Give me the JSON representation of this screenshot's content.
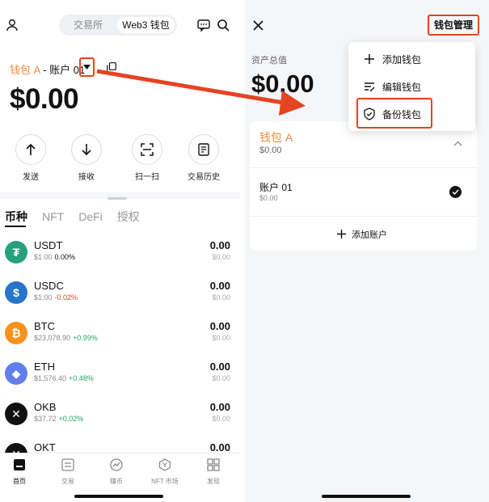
{
  "left": {
    "segment": {
      "option1": "交易所",
      "option2": "Web3 钱包"
    },
    "wallet_name": "钱包 A",
    "wallet_sep": " - ",
    "account_name": "账户 01",
    "balance": "$0.00",
    "actions": [
      {
        "label": "发送",
        "icon": "arrow-up-icon"
      },
      {
        "label": "接收",
        "icon": "arrow-down-icon"
      },
      {
        "label": "扫一扫",
        "icon": "scan-icon"
      },
      {
        "label": "交易历史",
        "icon": "history-icon"
      }
    ],
    "tabs": [
      "币种",
      "NFT",
      "DeFi",
      "授权"
    ],
    "tokens": [
      {
        "symbol": "USDT",
        "price": "$1.00",
        "change": "0.00%",
        "amount": "0.00",
        "usd": "$0.00",
        "color": "#26a17b",
        "glyph": "₮"
      },
      {
        "symbol": "USDC",
        "price": "$1.00",
        "change": "-0.02%",
        "amount": "0.00",
        "usd": "$0.00",
        "color": "#2775ca",
        "glyph": "$"
      },
      {
        "symbol": "BTC",
        "price": "$23,078.90",
        "change": "+0.99%",
        "amount": "0.00",
        "usd": "$0.00",
        "color": "#f7931a",
        "glyph": "₿"
      },
      {
        "symbol": "ETH",
        "price": "$1,576.40",
        "change": "+0.48%",
        "amount": "0.00",
        "usd": "$0.00",
        "color": "#627eea",
        "glyph": "◆"
      },
      {
        "symbol": "OKB",
        "price": "$37.72",
        "change": "+0.02%",
        "amount": "0.00",
        "usd": "$0.00",
        "color": "#111111",
        "glyph": "✕"
      },
      {
        "symbol": "OKT",
        "price": "",
        "change": "",
        "amount": "0.00",
        "usd": "",
        "color": "#111111",
        "glyph": "✕"
      }
    ],
    "nav": [
      "首页",
      "交易",
      "赚币",
      "NFT 市场",
      "发现"
    ]
  },
  "right": {
    "manage_label": "钱包管理",
    "asset_label": "资产总值",
    "asset_value": "$0.00",
    "menu": [
      {
        "label": "添加钱包",
        "icon": "plus-icon"
      },
      {
        "label": "编辑钱包",
        "icon": "edit-list-icon"
      },
      {
        "label": "备份钱包",
        "icon": "shield-icon"
      }
    ],
    "wallet_name": "钱包 A",
    "wallet_value": "$0.00",
    "account_name": "账户 01",
    "account_value": "$0.00",
    "add_account": "添加账户"
  },
  "colors": {
    "accent_orange": "#f08a3c",
    "highlight_red": "#e64322",
    "positive": "#22a46a",
    "negative": "#e64322"
  }
}
